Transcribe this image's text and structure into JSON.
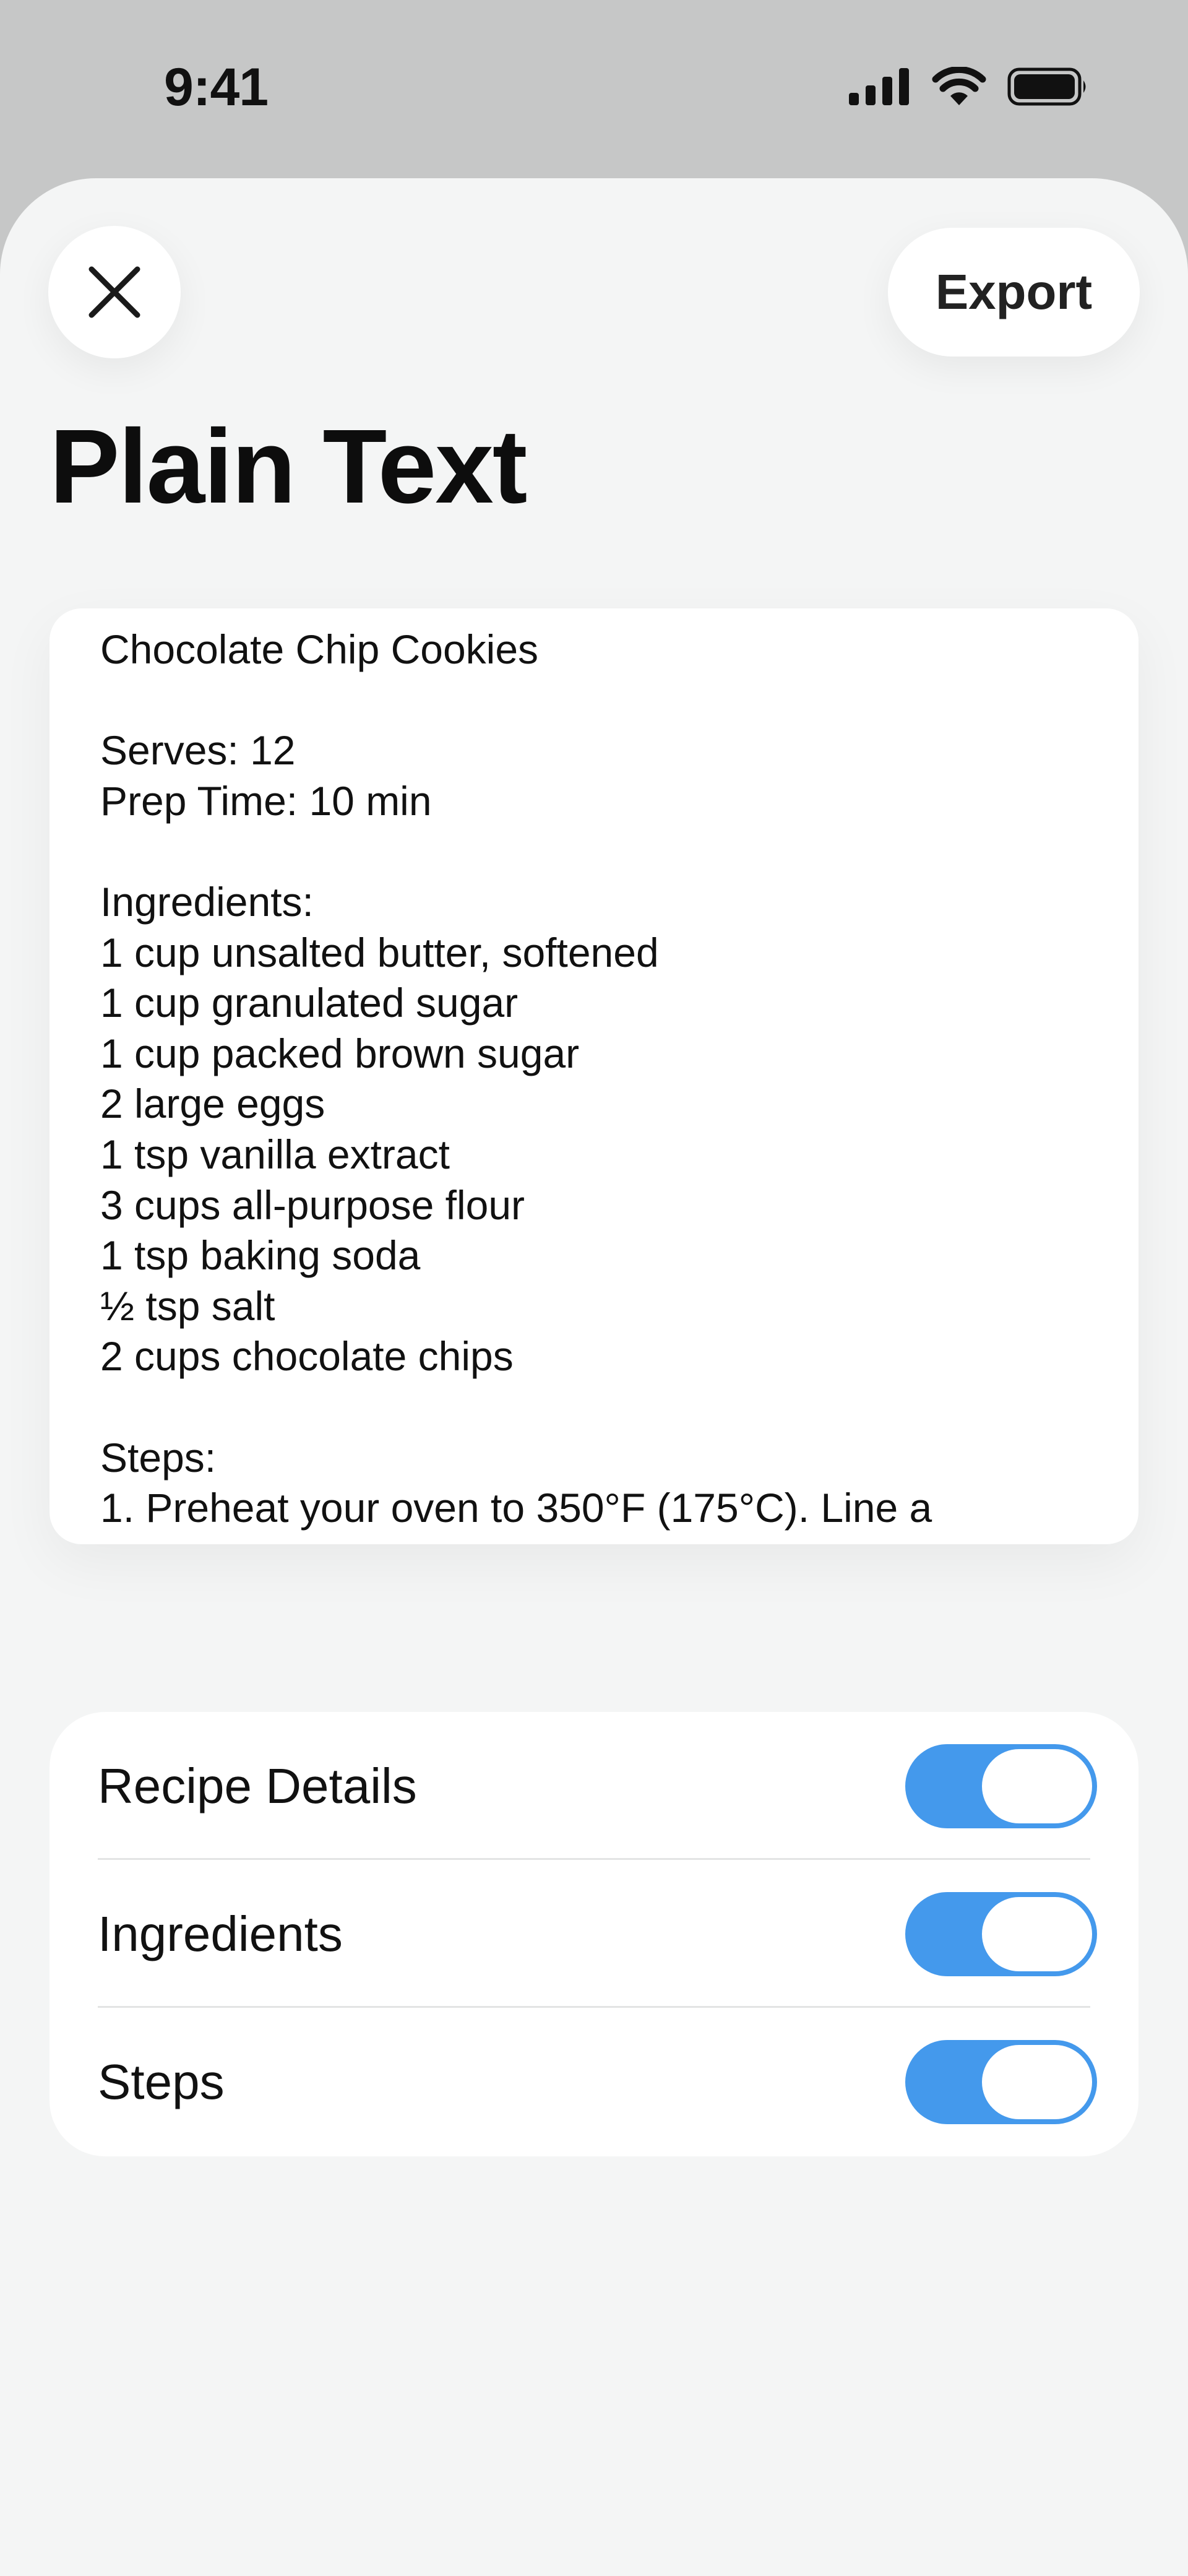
{
  "status_bar": {
    "time": "9:41",
    "icons": [
      "cellular-signal-icon",
      "wifi-icon",
      "battery-icon"
    ]
  },
  "header": {
    "close_icon": "close-icon",
    "export_label": "Export",
    "title": "Plain Text"
  },
  "preview": {
    "lines": [
      "Chocolate Chip Cookies",
      "",
      "Serves: 12",
      "Prep Time: 10 min",
      "",
      "Ingredients:",
      "1 cup unsalted butter, softened",
      "1 cup granulated sugar",
      "1 cup packed brown sugar",
      "2 large eggs",
      "1 tsp vanilla extract",
      "3 cups all-purpose flour",
      "1 tsp baking soda",
      "½ tsp salt",
      "2 cups chocolate chips",
      "",
      "Steps:",
      "1. Preheat your oven to 350°F (175°C). Line a"
    ]
  },
  "options": [
    {
      "label": "Recipe Details",
      "enabled": true
    },
    {
      "label": "Ingredients",
      "enabled": true
    },
    {
      "label": "Steps",
      "enabled": true
    }
  ],
  "colors": {
    "toggle_on": "#4499ec",
    "sheet_background": "#f4f5f5",
    "status_background": "#c6c7c7"
  }
}
